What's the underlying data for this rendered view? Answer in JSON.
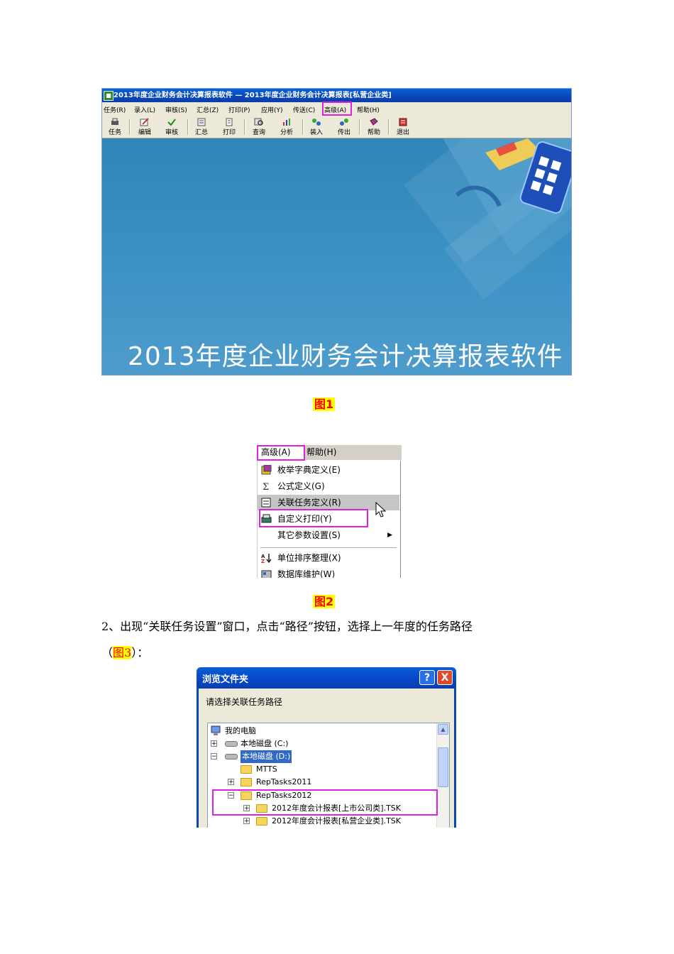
{
  "figure1": {
    "window_title": "2013年度企业财务会计决算报表软件 — 2013年度企业财务会计决算报表[私营企业类]",
    "menu": [
      "任务(R)",
      "录入(L)",
      "审核(S)",
      "汇总(Z)",
      "打印(P)",
      "应用(Y)",
      "传送(C)",
      "高级(A)",
      "帮助(H)"
    ],
    "toolbar": [
      "任务",
      "编辑",
      "审核",
      "汇总",
      "打印",
      "查询",
      "分析",
      "装入",
      "传出",
      "帮助",
      "退出"
    ],
    "splash_title": "2013年度企业财务会计决算报表软件",
    "caption": "图1"
  },
  "figure2": {
    "menu_advanced": "高级(A)",
    "menu_help": "帮助(H)",
    "items": [
      "枚举字典定义(E)",
      "公式定义(G)",
      "关联任务定义(R)",
      "自定义打印(Y)",
      "其它参数设置(S)",
      "单位排序整理(X)",
      "数据库维护(W)"
    ],
    "caption": "图2"
  },
  "instruction": {
    "line1": "2、出现“关联任务设置”窗口，点击“路径”按钮，选择上一年度的任务路径",
    "line2_open": "（",
    "line2_ref": "图3",
    "line2_close": "）："
  },
  "figure3": {
    "title": "浏览文件夹",
    "help_btn": "?",
    "close_btn": "X",
    "prompt": "请选择关联任务路径",
    "tree": {
      "my_computer": "我的电脑",
      "drive_c": "本地磁盘 (C:)",
      "drive_d": "本地磁盘 (D:)",
      "mtts": "MTTS",
      "rep2011": "RepTasks2011",
      "rep2012": "RepTasks2012",
      "tsk_listed": "2012年度会计报表[上市公司类].TSK",
      "tsk_private": "2012年度会计报表[私营企业类].TSK"
    }
  }
}
